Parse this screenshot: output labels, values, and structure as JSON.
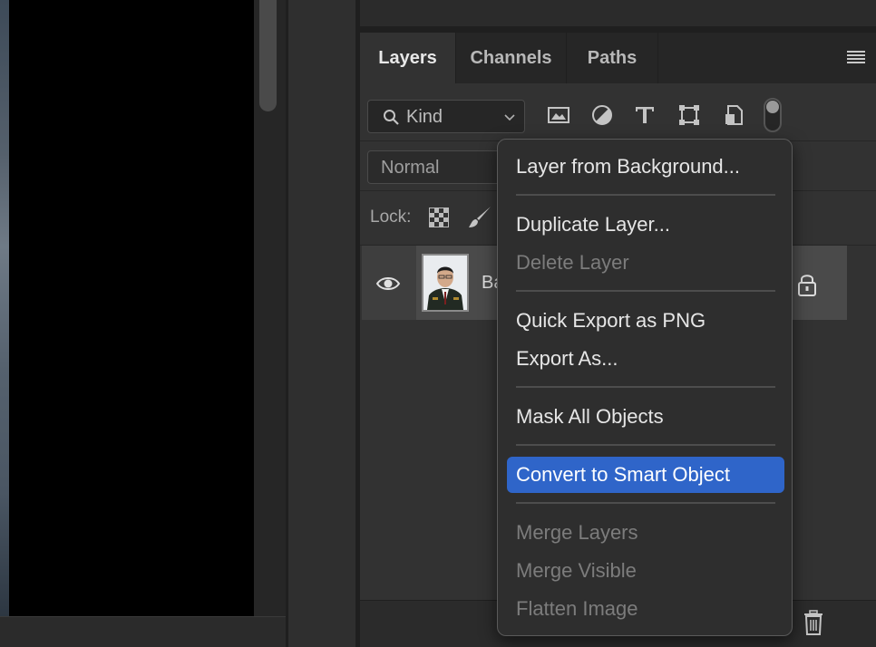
{
  "panel": {
    "tabs": [
      {
        "label": "Layers",
        "active": true
      },
      {
        "label": "Channels",
        "active": false
      },
      {
        "label": "Paths",
        "active": false
      }
    ],
    "filter": {
      "label": "Kind"
    },
    "blend_mode": "Normal",
    "lock_label": "Lock:",
    "layer": {
      "name": "Ba",
      "visible": true,
      "locked": true
    }
  },
  "context_menu": {
    "items": [
      {
        "label": "Layer from Background...",
        "enabled": true
      },
      {
        "label": "Duplicate Layer...",
        "enabled": true
      },
      {
        "label": "Delete Layer",
        "enabled": false
      },
      {
        "label": "Quick Export as PNG",
        "enabled": true
      },
      {
        "label": "Export As...",
        "enabled": true
      },
      {
        "label": "Mask All Objects",
        "enabled": true
      },
      {
        "label": "Convert to Smart Object",
        "enabled": true,
        "highlighted": true
      },
      {
        "label": "Merge Layers",
        "enabled": false
      },
      {
        "label": "Merge Visible",
        "enabled": false
      },
      {
        "label": "Flatten Image",
        "enabled": false
      }
    ]
  },
  "colors": {
    "highlight": "#2f65c9",
    "panel_bg": "#323232",
    "menu_bg": "#2e2e2e"
  }
}
